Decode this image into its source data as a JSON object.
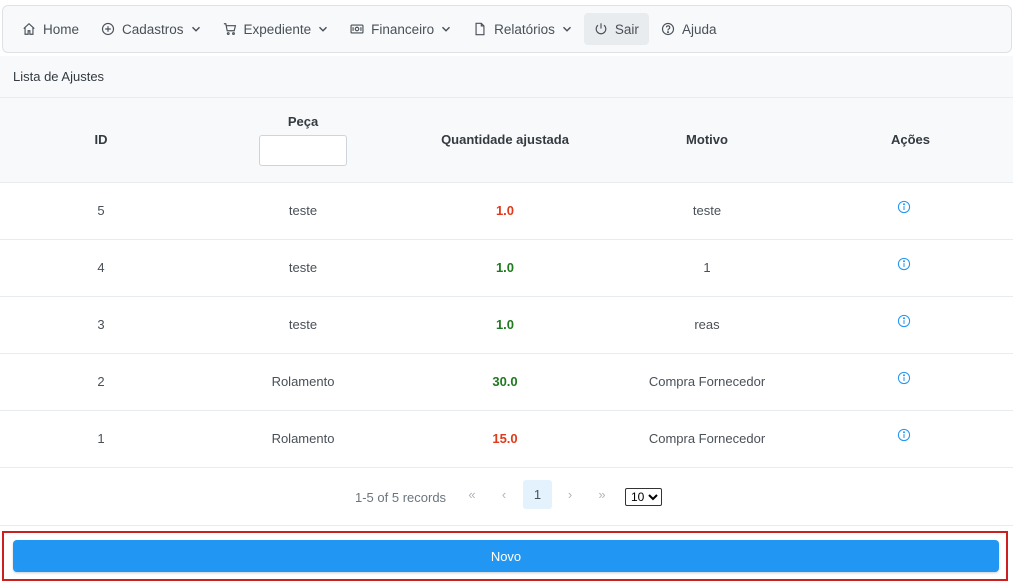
{
  "menubar": {
    "items": [
      {
        "label": "Home",
        "icon": "home-icon"
      },
      {
        "label": "Cadastros",
        "icon": "plus-circle-icon",
        "has_submenu": true
      },
      {
        "label": "Expediente",
        "icon": "shopping-cart-icon",
        "has_submenu": true
      },
      {
        "label": "Financeiro",
        "icon": "money-bill-icon",
        "has_submenu": true
      },
      {
        "label": "Relatórios",
        "icon": "file-icon",
        "has_submenu": true
      },
      {
        "label": "Sair",
        "icon": "power-off-icon",
        "active": true
      },
      {
        "label": "Ajuda",
        "icon": "question-circle-icon"
      }
    ]
  },
  "panel": {
    "title": "Lista de Ajustes"
  },
  "table": {
    "columns": [
      "ID",
      "Peça",
      "Quantidade ajustada",
      "Motivo",
      "Ações"
    ],
    "peca_filter_value": "",
    "rows": [
      {
        "id": "5",
        "peca": "teste",
        "quantidade": "1.0",
        "quantidade_color": "#e03a1a",
        "motivo": "teste"
      },
      {
        "id": "4",
        "peca": "teste",
        "quantidade": "1.0",
        "quantidade_color": "#1f7a1f",
        "motivo": "1"
      },
      {
        "id": "3",
        "peca": "teste",
        "quantidade": "1.0",
        "quantidade_color": "#1f7a1f",
        "motivo": "reas"
      },
      {
        "id": "2",
        "peca": "Rolamento",
        "quantidade": "30.0",
        "quantidade_color": "#1f7a1f",
        "motivo": "Compra Fornecedor"
      },
      {
        "id": "1",
        "peca": "Rolamento",
        "quantidade": "15.0",
        "quantidade_color": "#e03a1a",
        "motivo": "Compra Fornecedor"
      }
    ],
    "action_icon": "info-circle-icon"
  },
  "paginator": {
    "report": "1-5 of 5 records",
    "first": "«",
    "prev": "‹",
    "current_page": "1",
    "next": "›",
    "last": "»",
    "rows_per_page": "10"
  },
  "actions": {
    "novo_label": "Novo"
  },
  "colors": {
    "primary": "#2196f3",
    "highlight_border": "#cc1f1f",
    "negative": "#e03a1a",
    "positive": "#1f7a1f"
  }
}
